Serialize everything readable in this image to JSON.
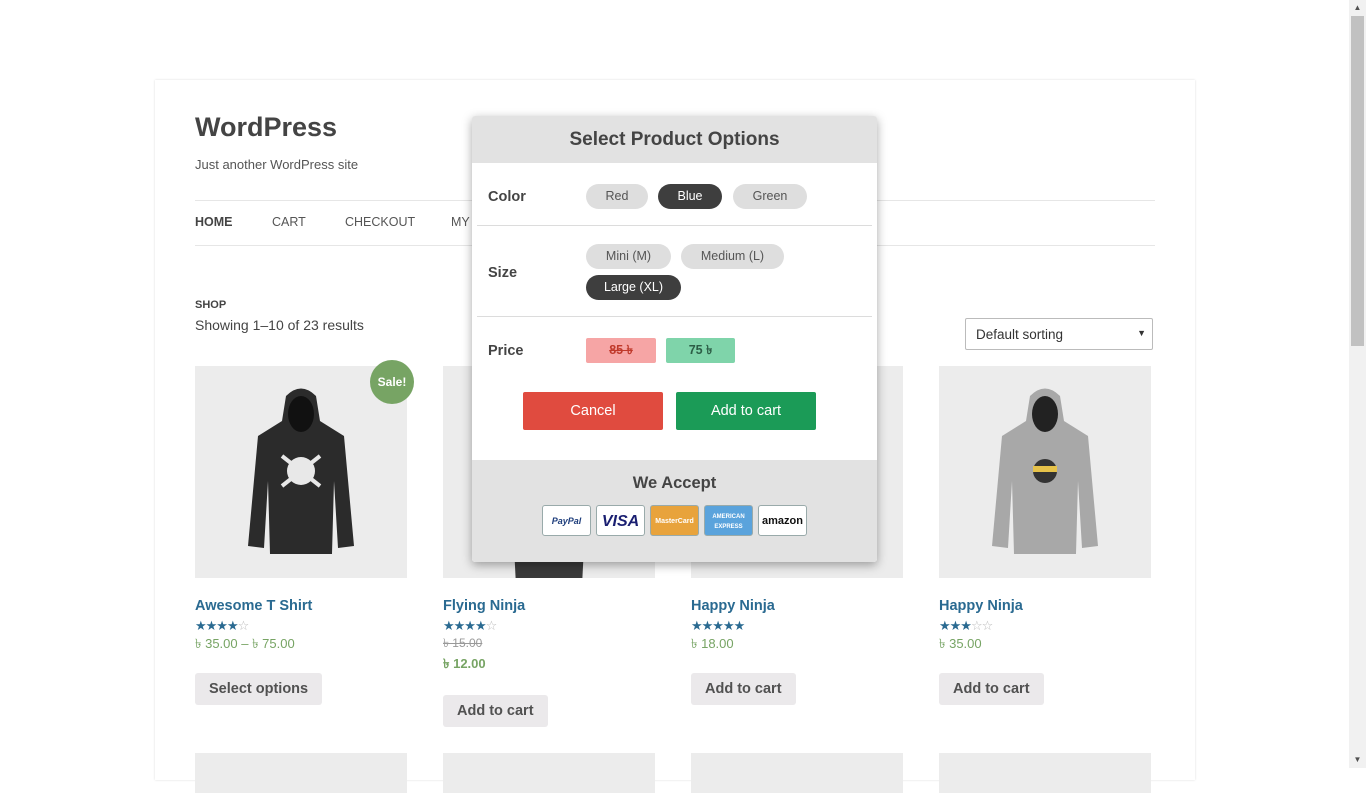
{
  "site": {
    "title": "WordPress",
    "description": "Just another WordPress site"
  },
  "nav": {
    "items": [
      "HOME",
      "CART",
      "CHECKOUT",
      "MY"
    ]
  },
  "shop": {
    "breadcrumb": "SHOP",
    "results_text": "Showing 1–10 of 23 results",
    "sorting_value": "Default sorting"
  },
  "products": [
    {
      "name": "Awesome T Shirt",
      "rating": 4,
      "price": "৳ 35.00 – ৳ 75.00",
      "button": "Select options",
      "badge": "Sale!",
      "hoodie_color": "#2b2b2b"
    },
    {
      "name": "Flying Ninja",
      "rating": 4,
      "old_price": "৳ 15.00",
      "new_price": "৳ 12.00",
      "button": "Add to cart",
      "hoodie_color": "#3a3a3a"
    },
    {
      "name": "Happy Ninja",
      "rating": 5,
      "price": "৳ 18.00",
      "button": "Add to cart",
      "hoodie_color": "#2f2f2f"
    },
    {
      "name": "Happy Ninja",
      "rating": 3,
      "price": "৳ 35.00",
      "button": "Add to cart",
      "hoodie_color": "#a8a8a8"
    }
  ],
  "modal": {
    "title": "Select Product Options",
    "color_label": "Color",
    "colors": [
      "Red",
      "Blue",
      "Green"
    ],
    "selected_color": "Blue",
    "size_label": "Size",
    "sizes": [
      "Mini (M)",
      "Medium (L)",
      "Large (XL)"
    ],
    "selected_size": "Large (XL)",
    "price_label": "Price",
    "old_price": "85 ৳",
    "new_price": "75 ৳",
    "cancel_label": "Cancel",
    "add_to_cart_label": "Add to cart",
    "accept_title": "We Accept",
    "cards": [
      "PayPal",
      "VISA",
      "MasterCard",
      "AMERICAN EXPRESS",
      "amazon"
    ]
  },
  "colors": {
    "accent_link": "#2a6a91",
    "sale_green": "#77a464",
    "cancel_red": "#e04b3f",
    "cart_green": "#1b9b57"
  }
}
